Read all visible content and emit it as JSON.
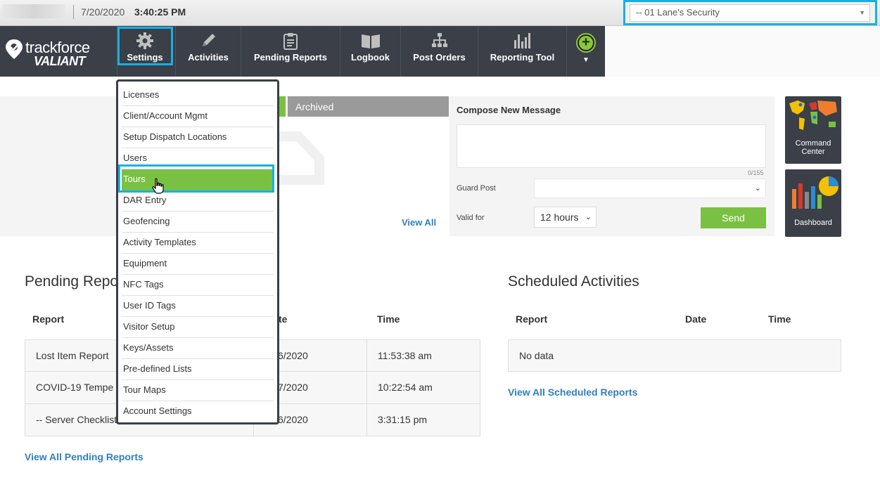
{
  "topbar": {
    "date": "7/20/2020",
    "time": "3:40:25 PM",
    "company_select": "-- 01 Lane's Security"
  },
  "logo": {
    "line1": "trackforce",
    "line2": "VALIANT"
  },
  "nav": {
    "settings": "Settings",
    "activities": "Activities",
    "pending_reports": "Pending Reports",
    "logbook": "Logbook",
    "post_orders": "Post Orders",
    "reporting_tool": "Reporting Tool"
  },
  "settings_menu": {
    "items": [
      "Licenses",
      "Client/Account Mgmt",
      "Setup Dispatch Locations",
      "Users",
      "Tours",
      "DAR Entry",
      "Geofencing",
      "Activity Templates",
      "Equipment",
      "NFC Tags",
      "User ID Tags",
      "Visitor Setup",
      "Keys/Assets",
      "Pre-defined Lists",
      "Tour Maps",
      "Account Settings"
    ],
    "selected": "Tours"
  },
  "messages": {
    "tab_archived": "Archived",
    "view_all": "View All",
    "compose_title": "Compose New Message",
    "char_count": "0/155",
    "guard_post_label": "Guard Post",
    "guard_post_value": "",
    "valid_for_label": "Valid for",
    "valid_for_value": "12 hours",
    "send_label": "Send"
  },
  "tiles": {
    "command_center_line1": "Command",
    "command_center_line2": "Center",
    "dashboard": "Dashboard"
  },
  "pending": {
    "title": "Pending Repo",
    "col_report": "Report",
    "col_date": "te",
    "col_time": "Time",
    "rows": [
      {
        "report": "Lost Item Report",
        "date": "6/2020",
        "time": "11:53:38 am"
      },
      {
        "report": "COVID-19 Tempe",
        "date": "7/2020",
        "time": "10:22:54 am"
      },
      {
        "report": "-- Server Checklist",
        "date": "6/2020",
        "time": "3:31:15 pm"
      }
    ],
    "view_all": "View All Pending Reports"
  },
  "scheduled": {
    "title": "Scheduled Activities",
    "col_report": "Report",
    "col_date": "Date",
    "col_time": "Time",
    "empty": "No data",
    "view_all": "View All Scheduled Reports"
  },
  "colors": {
    "accent_green": "#7ac143",
    "highlight_blue": "#17b0e4",
    "nav_bg": "#3a3f48",
    "link_blue": "#2e7fc0"
  },
  "icons": {
    "settings": "gear-icon",
    "activities": "pencil-icon",
    "pending_reports": "clipboard-icon",
    "logbook": "book-icon",
    "post_orders": "hierarchy-icon",
    "reporting_tool": "bar-chart-icon",
    "add": "plus-circle-icon"
  }
}
